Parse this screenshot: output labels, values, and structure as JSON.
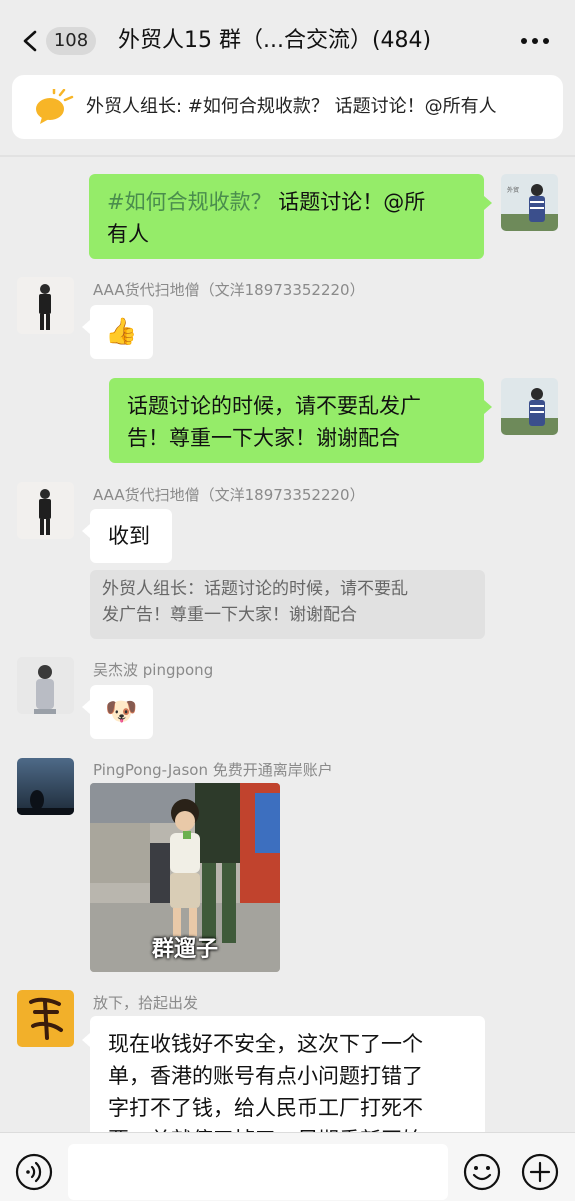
{
  "header": {
    "unread_count": "108",
    "title": "外贸人15 群（...合交流）(484)"
  },
  "pinned": {
    "text": "外贸人组长: #如何合规收款？ 话题讨论！@所有人"
  },
  "messages": [
    {
      "side": "out",
      "text_highlight": "#如何合规收款？",
      "text_line1_rest": " 话题讨论！@所",
      "text_line2": "有人"
    },
    {
      "side": "in",
      "sender": "AAA货代扫地僧（文洋18973352220）",
      "emoji": "👍"
    },
    {
      "side": "out",
      "line1": "话题讨论的时候，请不要乱发广",
      "line2": "告！尊重一下大家！谢谢配合"
    },
    {
      "side": "in",
      "sender": "AAA货代扫地僧（文洋18973352220）",
      "text": "收到",
      "quote_line1": "外贸人组长：话题讨论的时候，请不要乱",
      "quote_line2": "发广告！尊重一下大家！谢谢配合"
    },
    {
      "side": "in",
      "sender": "吴杰波 pingpong",
      "emoji": "🐶"
    },
    {
      "side": "in",
      "sender": "PingPong-Jason 免费开通离岸账户",
      "image_caption": "群遛子"
    },
    {
      "side": "in",
      "sender": "放下，拾起出发",
      "line1": "现在收钱好不安全，这次下了一个",
      "line2": "单，香港的账号有点小问题打错了",
      "line3": "字打不了钱，给人民币工厂打死不",
      "line4": "要，单就停了掉了，尽期重新开始"
    }
  ],
  "colors": {
    "chat_bg": "#ededed",
    "outgoing_bubble": "#95ec69",
    "incoming_bubble": "#ffffff",
    "highlight_text": "#4a8d4d"
  }
}
